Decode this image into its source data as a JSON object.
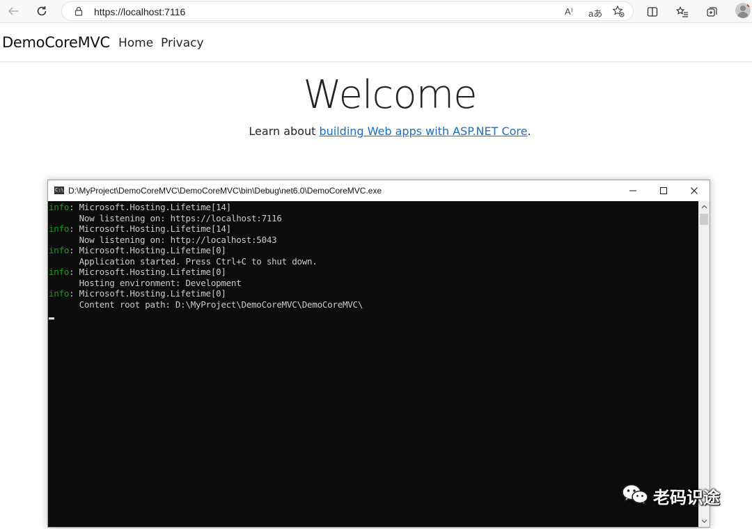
{
  "browser": {
    "url": "https://localhost:7116",
    "read_aloud_label": "A⁾",
    "translate_label": "aあ"
  },
  "site": {
    "brand": "DemoCoreMVC",
    "nav": [
      "Home",
      "Privacy"
    ]
  },
  "main": {
    "heading": "Welcome",
    "learn_prefix": "Learn about ",
    "learn_link": "building Web apps with ASP.NET Core",
    "learn_suffix": "."
  },
  "console": {
    "title": "D:\\MyProject\\DemoCoreMVC\\DemoCoreMVC\\bin\\Debug\\net6.0\\DemoCoreMVC.exe",
    "icon_label": "C:\\",
    "lines": [
      {
        "level": "info",
        "text": ": Microsoft.Hosting.Lifetime[14]"
      },
      {
        "level": "",
        "text": "      Now listening on: https://localhost:7116"
      },
      {
        "level": "info",
        "text": ": Microsoft.Hosting.Lifetime[14]"
      },
      {
        "level": "",
        "text": "      Now listening on: http://localhost:5043"
      },
      {
        "level": "info",
        "text": ": Microsoft.Hosting.Lifetime[0]"
      },
      {
        "level": "",
        "text": "      Application started. Press Ctrl+C to shut down."
      },
      {
        "level": "info",
        "text": ": Microsoft.Hosting.Lifetime[0]"
      },
      {
        "level": "",
        "text": "      Hosting environment: Development"
      },
      {
        "level": "info",
        "text": ": Microsoft.Hosting.Lifetime[0]"
      },
      {
        "level": "",
        "text": "      Content root path: D:\\MyProject\\DemoCoreMVC\\DemoCoreMVC\\"
      }
    ],
    "level_color": "#13a10e"
  },
  "watermark": {
    "text": "老码识途",
    "icon": "wechat-icon"
  }
}
